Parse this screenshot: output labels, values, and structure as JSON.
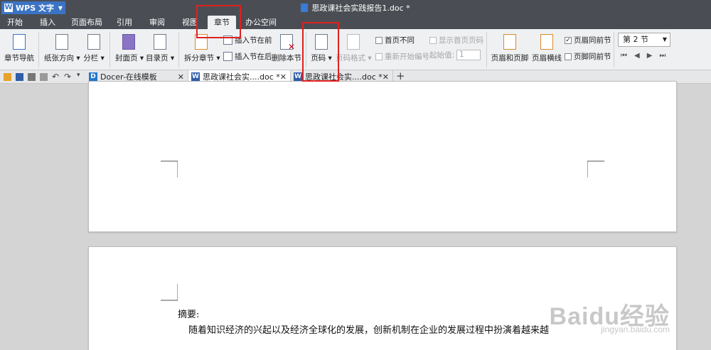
{
  "app": {
    "name": "WPS 文字",
    "doc_title": "思政课社会实践报告1.doc *"
  },
  "menu": [
    "开始",
    "插入",
    "页面布局",
    "引用",
    "审阅",
    "视图",
    "章节",
    "办公空间"
  ],
  "active_menu": "章节",
  "ribbon": {
    "chapter_nav": "章节导航",
    "paper_orientation": "纸张方向",
    "columns": "分栏",
    "cover_page": "封面页",
    "toc_page": "目录页",
    "split_chapter": "拆分章节",
    "insert_section_before": "插入节在前",
    "insert_section_after": "插入节在后",
    "delete_section": "删除本节",
    "page_number": "页码",
    "page_number_format": "页码格式",
    "first_page_different": "首页不同",
    "restart_numbering": "重新开始编号",
    "show_first_page_number": "显示首页页码",
    "start_value_label": "起始值:",
    "start_value": "1",
    "header_footer": "页眉和页脚",
    "header_line": "页眉横线",
    "header_same_prev": "页眉同前节",
    "footer_same_prev": "页脚同前节",
    "section_select": "第 2 节"
  },
  "tabs": [
    {
      "label": "Docer-在线模板"
    },
    {
      "label": "思政课社会实....doc *"
    },
    {
      "label": "思政课社会实....doc *"
    }
  ],
  "document": {
    "abstract_label": "摘要:",
    "abstract_line1": "随着知识经济的兴起以及经济全球化的发展，创新机制在企业的发展过程中扮演着越来越"
  },
  "watermark": {
    "logo": "Baidu经验",
    "url": "jingyan.baidu.com"
  },
  "colors": {
    "titlebar": "#4a4e54",
    "accent": "#3b73c4",
    "highlight": "#e02020",
    "ribbon_bg": "#eff0f2"
  }
}
